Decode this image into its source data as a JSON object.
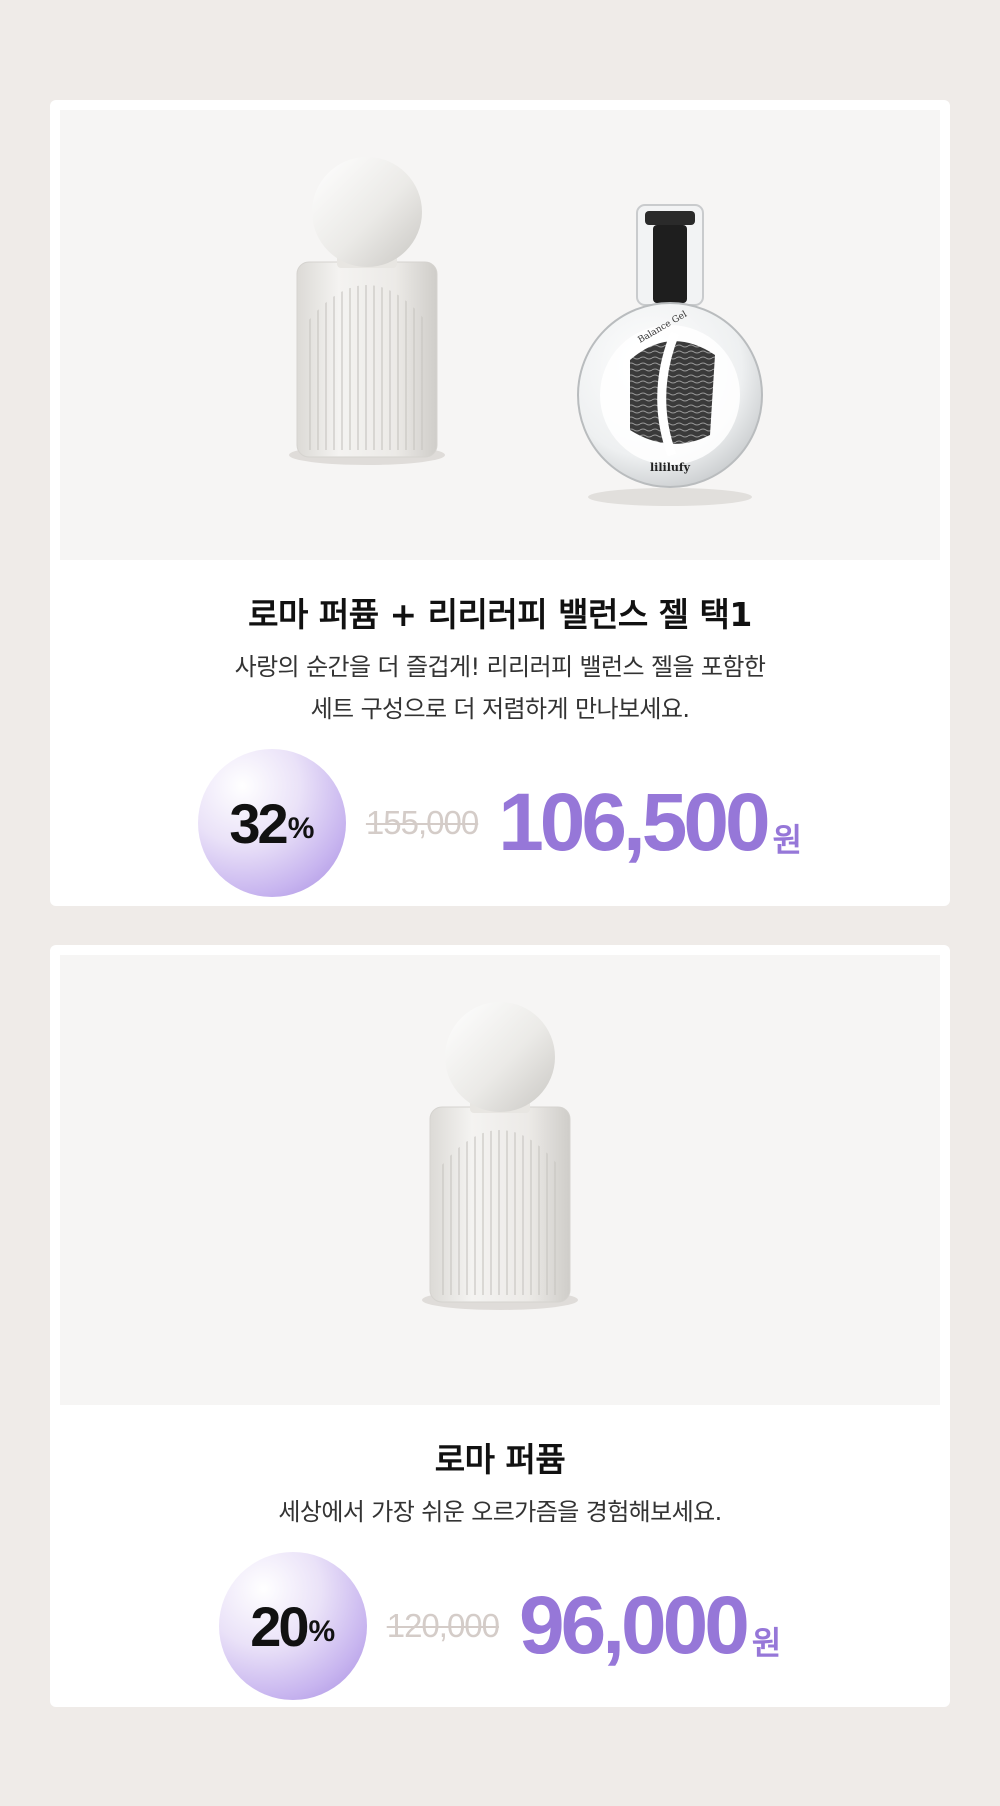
{
  "products": [
    {
      "title": "로마 퍼퓸 + 리리러피 밸런스 젤 택1",
      "description_lines": [
        "사랑의 순간을 더 즐겁게! 리리러피 밸런스 젤을 포함한",
        "세트 구성으로 더 저렴하게 만나보세요."
      ],
      "discount_number": "32",
      "discount_unit": "%",
      "original_price": "155,000",
      "sale_price": "106,500",
      "currency": "원",
      "images": [
        "roma-perfume-bottle",
        "lililufy-balance-gel-bottle"
      ],
      "gel_label_brand": "lililufy",
      "gel_label_name": "Balance Gel"
    },
    {
      "title": "로마 퍼퓸",
      "description_lines": [
        "세상에서 가장 쉬운 오르가즘을 경험해보세요."
      ],
      "discount_number": "20",
      "discount_unit": "%",
      "original_price": "120,000",
      "sale_price": "96,000",
      "currency": "원",
      "images": [
        "roma-perfume-bottle"
      ]
    }
  ],
  "colors": {
    "page_background": "#efebe8",
    "card_background": "#ffffff",
    "photo_background": "#f6f5f4",
    "accent_purple": "#9677d8",
    "strike_price": "#d4ccc8"
  }
}
